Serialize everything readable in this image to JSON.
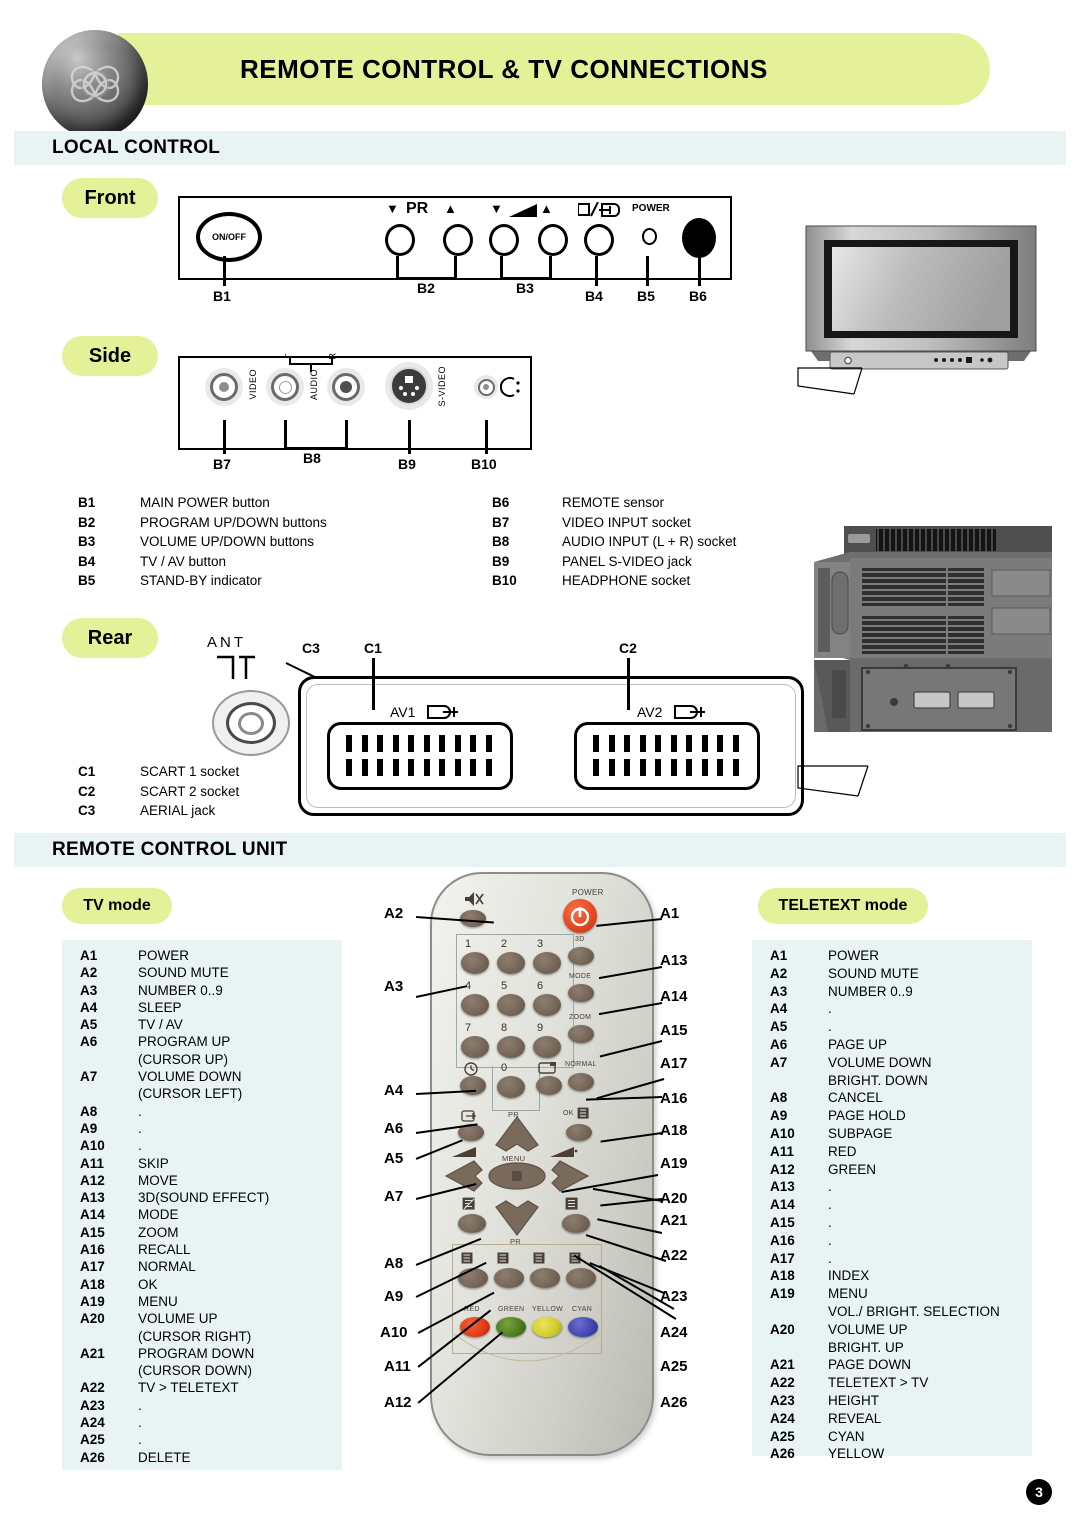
{
  "header": {
    "title": "REMOTE CONTROL & TV CONNECTIONS",
    "banner_color": "#e4f199",
    "logo_icon": "clover-sphere-logo"
  },
  "sections": {
    "local_control": "LOCAL CONTROL",
    "remote_control_unit": "REMOTE CONTROL UNIT"
  },
  "pills": {
    "front": "Front",
    "side": "Side",
    "rear": "Rear",
    "tv_mode": "TV mode",
    "teletext_mode": "TELETEXT mode"
  },
  "front_panel": {
    "onoff_label": "ON/OFF",
    "pr_label": "PR",
    "power_label": "POWER",
    "markers": [
      "B1",
      "B2",
      "B3",
      "B4",
      "B5",
      "B6"
    ]
  },
  "side_panel": {
    "video_label": "VIDEO",
    "audio_label": "AUDIO",
    "svideo_label": "S-VIDEO",
    "left_label": "L",
    "right_label": "R",
    "markers": [
      "B7",
      "B8",
      "B9",
      "B10"
    ]
  },
  "rear_panel": {
    "ant_label": "ANT",
    "av1_label": "AV1",
    "av2_label": "AV2",
    "markers": [
      "C3",
      "C1",
      "C2"
    ]
  },
  "legend_b_left": [
    {
      "code": "B1",
      "desc": "MAIN POWER button"
    },
    {
      "code": "B2",
      "desc": "PROGRAM UP/DOWN buttons"
    },
    {
      "code": "B3",
      "desc": "VOLUME UP/DOWN buttons"
    },
    {
      "code": "B4",
      "desc": "TV / AV button"
    },
    {
      "code": "B5",
      "desc": "STAND-BY indicator"
    }
  ],
  "legend_b_right": [
    {
      "code": "B6",
      "desc": "REMOTE sensor"
    },
    {
      "code": "B7",
      "desc": "VIDEO INPUT socket"
    },
    {
      "code": "B8",
      "desc": "AUDIO INPUT (L + R) socket"
    },
    {
      "code": "B9",
      "desc": "PANEL S-VIDEO jack"
    },
    {
      "code": "B10",
      "desc": "HEADPHONE socket"
    }
  ],
  "legend_c": [
    {
      "code": "C1",
      "desc": "SCART 1 socket"
    },
    {
      "code": "C2",
      "desc": "SCART 2 socket"
    },
    {
      "code": "C3",
      "desc": "AERIAL jack"
    }
  ],
  "tv_mode_list": [
    {
      "code": "A1",
      "desc": "POWER"
    },
    {
      "code": "A2",
      "desc": "SOUND MUTE"
    },
    {
      "code": "A3",
      "desc": "NUMBER 0..9"
    },
    {
      "code": "A4",
      "desc": "SLEEP"
    },
    {
      "code": "A5",
      "desc": "TV / AV"
    },
    {
      "code": "A6",
      "desc": "PROGRAM UP"
    },
    {
      "code": "",
      "desc": "(CURSOR UP)"
    },
    {
      "code": "A7",
      "desc": "VOLUME DOWN"
    },
    {
      "code": "",
      "desc": "(CURSOR LEFT)"
    },
    {
      "code": "A8",
      "desc": "."
    },
    {
      "code": "A9",
      "desc": "."
    },
    {
      "code": "A10",
      "desc": "."
    },
    {
      "code": "A11",
      "desc": "SKIP"
    },
    {
      "code": "A12",
      "desc": "MOVE"
    },
    {
      "code": "A13",
      "desc": "3D(SOUND EFFECT)"
    },
    {
      "code": "A14",
      "desc": "MODE"
    },
    {
      "code": "A15",
      "desc": "ZOOM"
    },
    {
      "code": "A16",
      "desc": "RECALL"
    },
    {
      "code": "A17",
      "desc": "NORMAL"
    },
    {
      "code": "A18",
      "desc": "OK"
    },
    {
      "code": "A19",
      "desc": "MENU"
    },
    {
      "code": "A20",
      "desc": "VOLUME UP"
    },
    {
      "code": "",
      "desc": "(CURSOR RIGHT)"
    },
    {
      "code": "A21",
      "desc": "PROGRAM DOWN"
    },
    {
      "code": "",
      "desc": "(CURSOR DOWN)"
    },
    {
      "code": "A22",
      "desc": "TV > TELETEXT"
    },
    {
      "code": "A23",
      "desc": "."
    },
    {
      "code": "A24",
      "desc": "."
    },
    {
      "code": "A25",
      "desc": "."
    },
    {
      "code": "A26",
      "desc": "DELETE"
    }
  ],
  "teletext_mode_list": [
    {
      "code": "A1",
      "desc": "POWER"
    },
    {
      "code": "A2",
      "desc": "SOUND MUTE"
    },
    {
      "code": "A3",
      "desc": "NUMBER 0..9"
    },
    {
      "code": "A4",
      "desc": "."
    },
    {
      "code": "A5",
      "desc": "."
    },
    {
      "code": "A6",
      "desc": "PAGE UP"
    },
    {
      "code": "A7",
      "desc": "VOLUME DOWN"
    },
    {
      "code": "",
      "desc": "BRIGHT. DOWN"
    },
    {
      "code": "A8",
      "desc": "CANCEL"
    },
    {
      "code": "A9",
      "desc": "PAGE HOLD"
    },
    {
      "code": "A10",
      "desc": "SUBPAGE"
    },
    {
      "code": "A11",
      "desc": "RED"
    },
    {
      "code": "A12",
      "desc": "GREEN"
    },
    {
      "code": "A13",
      "desc": "."
    },
    {
      "code": "A14",
      "desc": "."
    },
    {
      "code": "A15",
      "desc": "."
    },
    {
      "code": "A16",
      "desc": "."
    },
    {
      "code": "A17",
      "desc": "."
    },
    {
      "code": "A18",
      "desc": "INDEX"
    },
    {
      "code": "A19",
      "desc": "MENU"
    },
    {
      "code": "",
      "desc": "VOL./ BRIGHT. SELECTION"
    },
    {
      "code": "A20",
      "desc": "VOLUME UP"
    },
    {
      "code": "",
      "desc": "BRIGHT. UP"
    },
    {
      "code": "A21",
      "desc": "PAGE DOWN"
    },
    {
      "code": "A22",
      "desc": "TELETEXT > TV"
    },
    {
      "code": "A23",
      "desc": "HEIGHT"
    },
    {
      "code": "A24",
      "desc": "REVEAL"
    },
    {
      "code": "A25",
      "desc": "CYAN"
    },
    {
      "code": "A26",
      "desc": "YELLOW"
    }
  ],
  "remote": {
    "power_label": "POWER",
    "btn_3d": "3D",
    "btn_mode": "MODE",
    "btn_zoom": "ZOOM",
    "btn_normal": "NORMAL",
    "btn_ok": "OK",
    "btn_menu": "MENU",
    "btn_pr_top": "PR",
    "btn_pr_bottom": "PR",
    "color_red": "RED",
    "color_green": "GREEN",
    "color_yellow": "YELLOW",
    "color_cyan": "CYAN",
    "numbers": [
      "1",
      "2",
      "3",
      "4",
      "5",
      "6",
      "7",
      "8",
      "9",
      "0"
    ],
    "callouts_left": [
      "A2",
      "A3",
      "A4",
      "A6",
      "A5",
      "A7",
      "A8",
      "A9",
      "A10",
      "A11",
      "A12"
    ],
    "callouts_right": [
      "A1",
      "A13",
      "A14",
      "A15",
      "A17",
      "A16",
      "A18",
      "A19",
      "A20",
      "A21",
      "A22",
      "A23",
      "A24",
      "A25",
      "A26"
    ]
  },
  "page_number": "3"
}
